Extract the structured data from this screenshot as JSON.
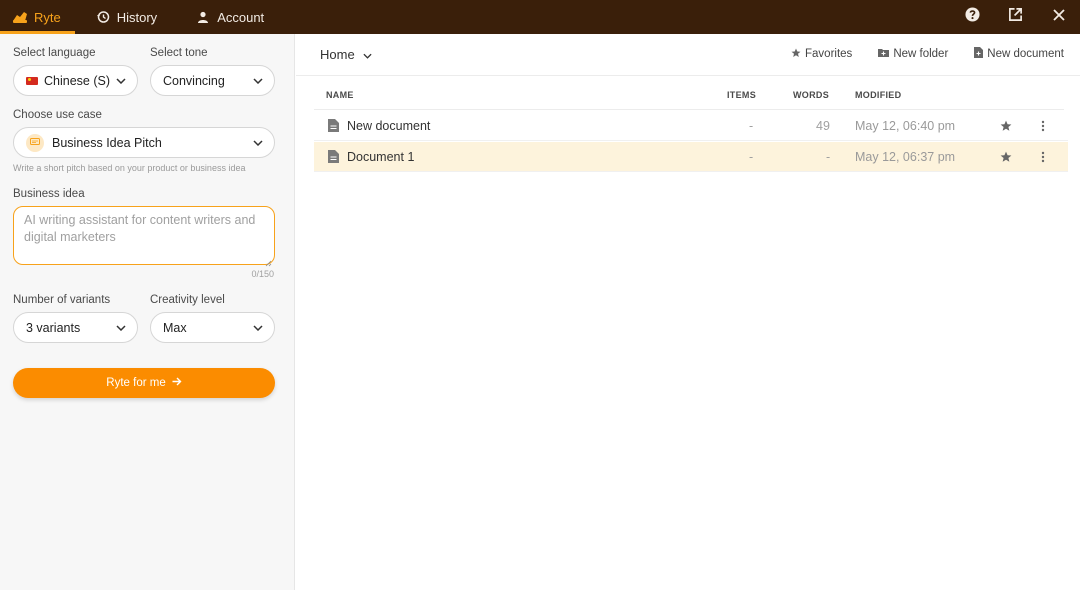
{
  "topbar": {
    "tabs": [
      {
        "label": "Ryte",
        "icon": "ryte-logo-icon",
        "active": true
      },
      {
        "label": "History",
        "icon": "history-icon",
        "active": false
      },
      {
        "label": "Account",
        "icon": "person-icon",
        "active": false
      }
    ],
    "actions": [
      "help-icon",
      "open-external-icon",
      "close-icon"
    ]
  },
  "form": {
    "language": {
      "label": "Select language",
      "value": "Chinese (S)"
    },
    "tone": {
      "label": "Select tone",
      "value": "Convincing"
    },
    "use_case": {
      "label": "Choose use case",
      "value": "Business Idea Pitch",
      "hint": "Write a short pitch based on your product or business idea"
    },
    "business_idea": {
      "label": "Business idea",
      "placeholder": "AI writing assistant for content writers and digital marketers",
      "counter": "0/150"
    },
    "variants": {
      "label": "Number of variants",
      "value": "3 variants"
    },
    "creativity": {
      "label": "Creativity level",
      "value": "Max"
    },
    "cta_label": "Ryte for me"
  },
  "browser": {
    "breadcrumb": "Home",
    "actions": {
      "favorites": "Favorites",
      "new_folder": "New folder",
      "new_document": "New document"
    },
    "columns": {
      "name": "NAME",
      "items": "ITEMS",
      "words": "WORDS",
      "modified": "MODIFIED"
    },
    "rows": [
      {
        "name": "New document",
        "items": "-",
        "words": "49",
        "modified": "May 12, 06:40 pm"
      },
      {
        "name": "Document 1",
        "items": "-",
        "words": "-",
        "modified": "May 12, 06:37 pm"
      }
    ]
  },
  "colors": {
    "accent": "#f7a21b",
    "cta": "#fb8c00",
    "topbar": "#3a1f0a",
    "selected_row": "#fdf3dc"
  }
}
